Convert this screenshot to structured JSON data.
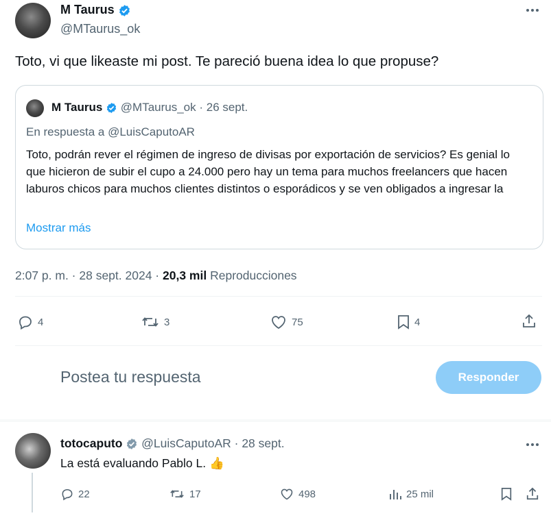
{
  "tweet": {
    "author_name": "M Taurus",
    "author_handle": "@MTaurus_ok",
    "text": "Toto, vi que likeaste mi post. Te pareció buena idea lo que propuse?",
    "timestamp": "2:07 p. m. · 28 sept. 2024 ·",
    "views_count": "20,3 mil",
    "views_label": "Reproducciones",
    "more_icon": "more-horizontal-icon",
    "actions": {
      "replies": "4",
      "retweets": "3",
      "likes": "75",
      "bookmarks": "4"
    }
  },
  "quoted": {
    "author_name": "M Taurus",
    "meta": "@MTaurus_ok · 26 sept.",
    "reply_to": "En respuesta a @LuisCaputoAR",
    "text": "Toto, podrán rever el régimen de ingreso de divisas por exportación de servicios? Es genial lo que hicieron de subir el cupo a 24.000 pero hay un tema para muchos freelancers que hacen laburos chicos para muchos clientes distintos o esporádicos y se ven obligados a ingresar la",
    "show_more": "Mostrar más"
  },
  "composer": {
    "placeholder": "Postea tu respuesta",
    "button_label": "Responder"
  },
  "reply": {
    "author_name": "totocaputo",
    "meta": "@LuisCaputoAR · 28 sept.",
    "text": "La está evaluando Pablo L.",
    "emoji": "👍",
    "actions": {
      "replies": "22",
      "retweets": "17",
      "likes": "498",
      "views": "25 mil"
    }
  },
  "colors": {
    "accent": "#1d9bf0",
    "button_disabled": "#8ecdf8",
    "muted": "#536471"
  }
}
